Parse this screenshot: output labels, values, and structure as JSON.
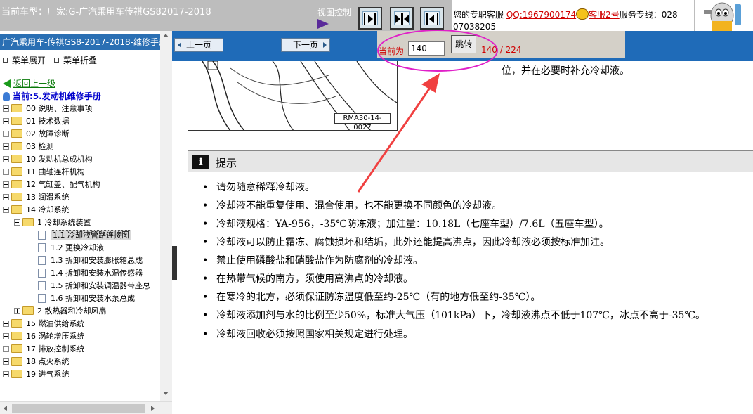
{
  "header": {
    "car_title": "当前车型：厂家:G-广汽乘用车传祺GS82017-2018",
    "view_control_label": "视图控制",
    "support_prefix": "您的专职客服",
    "support_qq": "QQ:1967900174",
    "support_agent": "客服2号",
    "support_hotline_label": "服务专线：028-",
    "support_hotline_number": "07038205"
  },
  "sidebar": {
    "manual_title": "广汽乘用车-传祺GS8-2017-2018-维修手册",
    "expand_label": "菜单展开",
    "collapse_label": "菜单折叠",
    "back_label": "返回上一级",
    "current_label": "当前:5.发动机维修手册",
    "tree": [
      {
        "label": "00 说明、注意事项"
      },
      {
        "label": "01 技术数据"
      },
      {
        "label": "02 故障诊断"
      },
      {
        "label": "03 检测"
      },
      {
        "label": "10 发动机总成机构"
      },
      {
        "label": "11 曲轴连杆机构"
      },
      {
        "label": "12 气缸盖、配气机构"
      },
      {
        "label": "13 润滑系统"
      },
      {
        "label": "14 冷却系统"
      },
      {
        "label": "1 冷却系统装置"
      },
      {
        "label": "1.1 冷却液管路连接图"
      },
      {
        "label": "1.2 更换冷却液"
      },
      {
        "label": "1.3 拆卸和安装膨胀箱总成"
      },
      {
        "label": "1.4 拆卸和安装水温传感器"
      },
      {
        "label": "1.5 拆卸和安装调温器带座总"
      },
      {
        "label": "1.6 拆卸和安装水泵总成"
      },
      {
        "label": "2 散热器和冷却风扇"
      },
      {
        "label": "15 燃油供给系统"
      },
      {
        "label": "16 涡轮增压系统"
      },
      {
        "label": "17 排放控制系统"
      },
      {
        "label": "18 点火系统"
      },
      {
        "label": "19 进气系统"
      }
    ]
  },
  "nav": {
    "prev_label": "上一页",
    "next_label": "下一页",
    "current_label": "当前为",
    "page_value": "140",
    "jump_label": "跳转",
    "page_count": "140 / 224"
  },
  "document": {
    "figure_code": "RMA30-14-0027",
    "coolant_text": "位，并在必要时补充冷却液。",
    "tip_title": "提示",
    "tips": [
      "请勿随意稀释冷却液。",
      "冷却液不能重复使用、混合使用，也不能更换不同颜色的冷却液。",
      "冷却液规格：YA-956，-35℃防冻液；加注量：10.18L（七座车型）/7.6L（五座车型）。",
      "冷却液可以防止霜冻、腐蚀损坏和结垢，此外还能提高沸点，因此冷却液必须按标准加注。",
      "禁止使用磷酸盐和硝酸盐作为防腐剂的冷却液。",
      "在热带气候的南方，须使用高沸点的冷却液。",
      "在寒冷的北方，必须保证防冻温度低至约-25℃（有的地方低至约-35℃）。",
      "冷却液添加剂与水的比例至少50%，标准大气压（101kPa）下，冷却液沸点不低于107℃，冰点不高于-35℃。",
      "冷却液回收必须按照国家相关规定进行处理。"
    ],
    "bullet": "•"
  },
  "colors": {
    "header_bg": "#bdbdbd",
    "nav_bar": "#1f6bb8",
    "highlight_ellipse": "#e020c8",
    "annotation_arrow": "#f04040",
    "accent_red": "#d00000"
  },
  "icons": {
    "view_toggle_left": "panel-left-icon",
    "view_toggle_split": "panel-split-icon",
    "view_toggle_right": "panel-right-icon",
    "qq": "qq-penguin-icon",
    "mascot": "mascot-icon",
    "back": "back-arrow-icon",
    "info": "info-icon"
  }
}
